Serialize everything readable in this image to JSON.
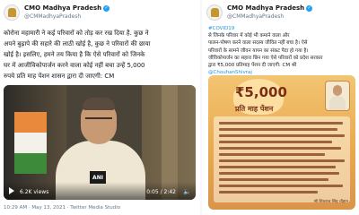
{
  "left_tweet": {
    "account_name": "CMO Madhya Pradesh",
    "handle": "@CMMadhyaPradesh",
    "text_lines": [
      "कोरोना महामारी ने कई परिवारों को तोड़ कर रख दिया है. कुछ ने",
      "अपने बुढ़ापे की सहारे की लाठी खोई है, कुछ ने परिवारों की छाया",
      "खोई है। इसलिए, हमने तय किया है कि ऐसे परिवारों को जिनके",
      "घर में आजीविकोपार्जन करने वाला कोई नहीं बचा उन्हें 5,000",
      "रुपये प्रति माह पेंशन शासन द्वारा दी जाएगी: CM"
    ],
    "video": {
      "views": "6.2K views",
      "duration": "0:05 / 2:42",
      "mic_label": "ANI"
    },
    "timestamp": "10:29 AM · May 13, 2021 · Twitter Media Studio"
  },
  "right_tweet": {
    "account_name": "CMO Madhya Pradesh",
    "handle": "@CMMadhyaPradesh",
    "text_lines": [
      "#COVID19 से जिनके परिवार में कोई भी कमाने वाला और",
      "पालन-पोषण करने वाला सदस्य जीवित नहीं बचा है। ऐसे",
      "परिवारों के सामने जीवन यापन का संकट पैदा हो गया है।",
      "जीविकोपार्जन का सहारा छिन गया ऐसे परिवारों को प्रदेश सरकार",
      "द्वारा ₹5,000 प्रतिमाह पेंशन दी जाएगी: CM श्री",
      "@ChouhanShivraj"
    ],
    "hashtag": "#COVID19",
    "mention": "@ChouhanShivraj",
    "poster": {
      "amount": "₹5,000",
      "subtitle": "प्रति माह पेंशन",
      "signature": "श्री शिवराज सिंह चौहान"
    }
  },
  "colors": {
    "link": "#1b95e0",
    "verified": "#1da1f2",
    "poster_accent": "#7a2f14"
  }
}
